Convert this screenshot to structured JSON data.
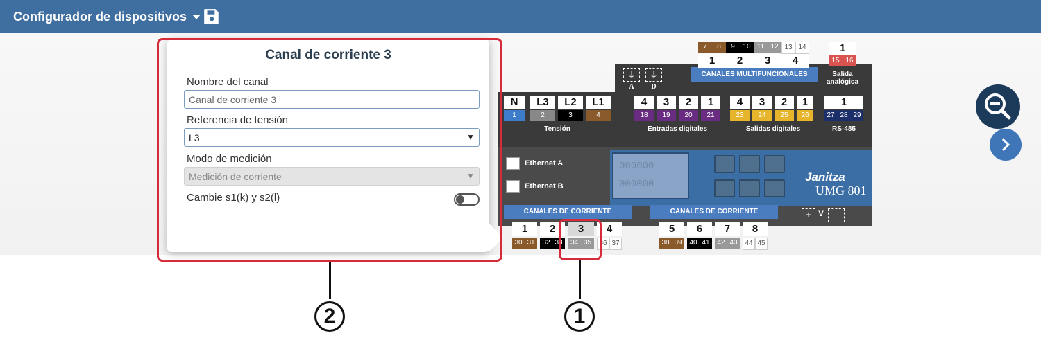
{
  "app": {
    "title": "Configurador de dispositivos"
  },
  "popover": {
    "title": "Canal de corriente 3",
    "name_label": "Nombre del canal",
    "name_value": "Canal de corriente 3",
    "ref_label": "Referencia de tensión",
    "ref_value": "L3",
    "mode_label": "Modo de medición",
    "mode_value": "Medición de corriente",
    "swap_label": "Cambie s1(k) y s2(l)",
    "swap_on": false
  },
  "device": {
    "brand": "Janitza",
    "model": "UMG 801",
    "display_digits": [
      "000000",
      "000000"
    ],
    "multi_header": "CANALES MULTIFUNCIONALES",
    "multi_terms": [
      {
        "num": "1",
        "pins": [
          "7",
          "8"
        ]
      },
      {
        "num": "2",
        "pins": [
          "9",
          "10"
        ]
      },
      {
        "num": "3",
        "pins": [
          "11",
          "12"
        ]
      },
      {
        "num": "4",
        "pins": [
          "13",
          "14"
        ]
      }
    ],
    "analog": {
      "num": "1",
      "pins": [
        "15",
        "16"
      ],
      "label_1": "Salida",
      "label_2": "analógica"
    },
    "ground_labels": [
      "A",
      "D"
    ],
    "voltage": {
      "label": "Tensión",
      "terms": [
        {
          "num": "N",
          "pin": "1"
        },
        {
          "num": "L3",
          "pin": "2"
        },
        {
          "num": "L2",
          "pin": "3"
        },
        {
          "num": "L1",
          "pin": "4"
        }
      ]
    },
    "digital_in": {
      "label": "Entradas digitales",
      "terms": [
        {
          "num": "4",
          "pin": "18"
        },
        {
          "num": "3",
          "pin": "19"
        },
        {
          "num": "2",
          "pin": "20"
        },
        {
          "num": "1",
          "pin": "21"
        }
      ]
    },
    "digital_out": {
      "label": "Salidas digitales",
      "terms": [
        {
          "num": "4",
          "pin": "23"
        },
        {
          "num": "3",
          "pin": "24"
        },
        {
          "num": "2",
          "pin": "25"
        },
        {
          "num": "1",
          "pin": "26"
        }
      ]
    },
    "rs485": {
      "label": "RS-485",
      "num": "1",
      "pins": [
        "27",
        "28",
        "29"
      ]
    },
    "ethernet": [
      "Ethernet A",
      "Ethernet B"
    ],
    "current_header_1": "CANALES DE CORRIENTE",
    "current_header_2": "CANALES DE CORRIENTE",
    "current_1": [
      {
        "num": "1",
        "pins": [
          "30",
          "31"
        ]
      },
      {
        "num": "2",
        "pins": [
          "32",
          "33"
        ]
      },
      {
        "num": "3",
        "pins": [
          "34",
          "35"
        ]
      },
      {
        "num": "4",
        "pins": [
          "36",
          "37"
        ]
      }
    ],
    "current_2": [
      {
        "num": "5",
        "pins": [
          "38",
          "39"
        ]
      },
      {
        "num": "6",
        "pins": [
          "40",
          "41"
        ]
      },
      {
        "num": "7",
        "pins": [
          "42",
          "43"
        ]
      },
      {
        "num": "8",
        "pins": [
          "44",
          "45"
        ]
      }
    ],
    "supply_symbols": [
      "+",
      "V",
      "—"
    ]
  },
  "callouts": [
    "1",
    "2"
  ],
  "colors": {
    "topbar": "#3f6ea0",
    "highlight": "#d52b3a",
    "brown": "#8b5a2b",
    "purple": "#6a2b82",
    "yellow": "#e7b52c",
    "navy": "#1d2f6b",
    "blue": "#4a7dc0"
  }
}
